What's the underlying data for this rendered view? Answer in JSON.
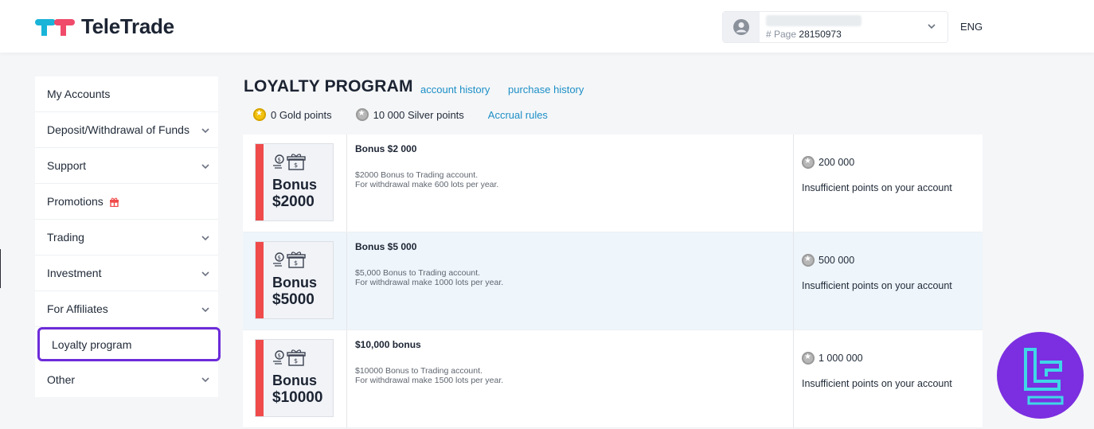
{
  "brand": {
    "name": "TeleTrade"
  },
  "account": {
    "page_prefix": "# Page",
    "page_number": "28150973"
  },
  "language": "ENG",
  "sidebar": {
    "items": [
      {
        "label": "My Accounts",
        "chevron": false
      },
      {
        "label": "Deposit/Withdrawal of Funds",
        "chevron": true
      },
      {
        "label": "Support",
        "chevron": true
      },
      {
        "label": "Promotions",
        "chevron": false,
        "icon": "gift-icon"
      },
      {
        "label": "Trading",
        "chevron": true
      },
      {
        "label": "Investment",
        "chevron": true
      },
      {
        "label": "For Affiliates",
        "chevron": true
      },
      {
        "label": "Loyalty program",
        "chevron": false,
        "active": true
      },
      {
        "label": "Other",
        "chevron": true
      }
    ]
  },
  "main": {
    "title": "LOYALTY PROGRAM",
    "links": {
      "history": "account history",
      "purchase": "purchase history"
    },
    "points": {
      "gold": "0 Gold points",
      "silver": "10 000 Silver points",
      "rules": "Accrual rules"
    },
    "rewards": [
      {
        "card_line1": "Bonus",
        "card_line2": "$2000",
        "title": "Bonus $2 000",
        "desc1": "$2000 Bonus to Trading account.",
        "desc2": "For withdrawal make 600 lots per year.",
        "price": "200 000",
        "status": "Insufficient points on your account"
      },
      {
        "card_line1": "Bonus",
        "card_line2": "$5000",
        "title": "Bonus $5 000",
        "desc1": "$5,000 Bonus to Trading account.",
        "desc2": "For withdrawal make 1000 lots per year.",
        "price": "500 000",
        "status": "Insufficient points on your account"
      },
      {
        "card_line1": "Bonus",
        "card_line2": "$10000",
        "title": "$10,000 bonus",
        "desc1": "$10000 Bonus to Trading account.",
        "desc2": "For withdrawal make 1500 lots per year.",
        "price": "1 000 000",
        "status": "Insufficient points on your account"
      }
    ]
  },
  "colors": {
    "accent": "#1c8fc6",
    "active_border": "#6c2bd9",
    "card_bar": "#f04b4b",
    "badge": "#7b2fe0"
  }
}
